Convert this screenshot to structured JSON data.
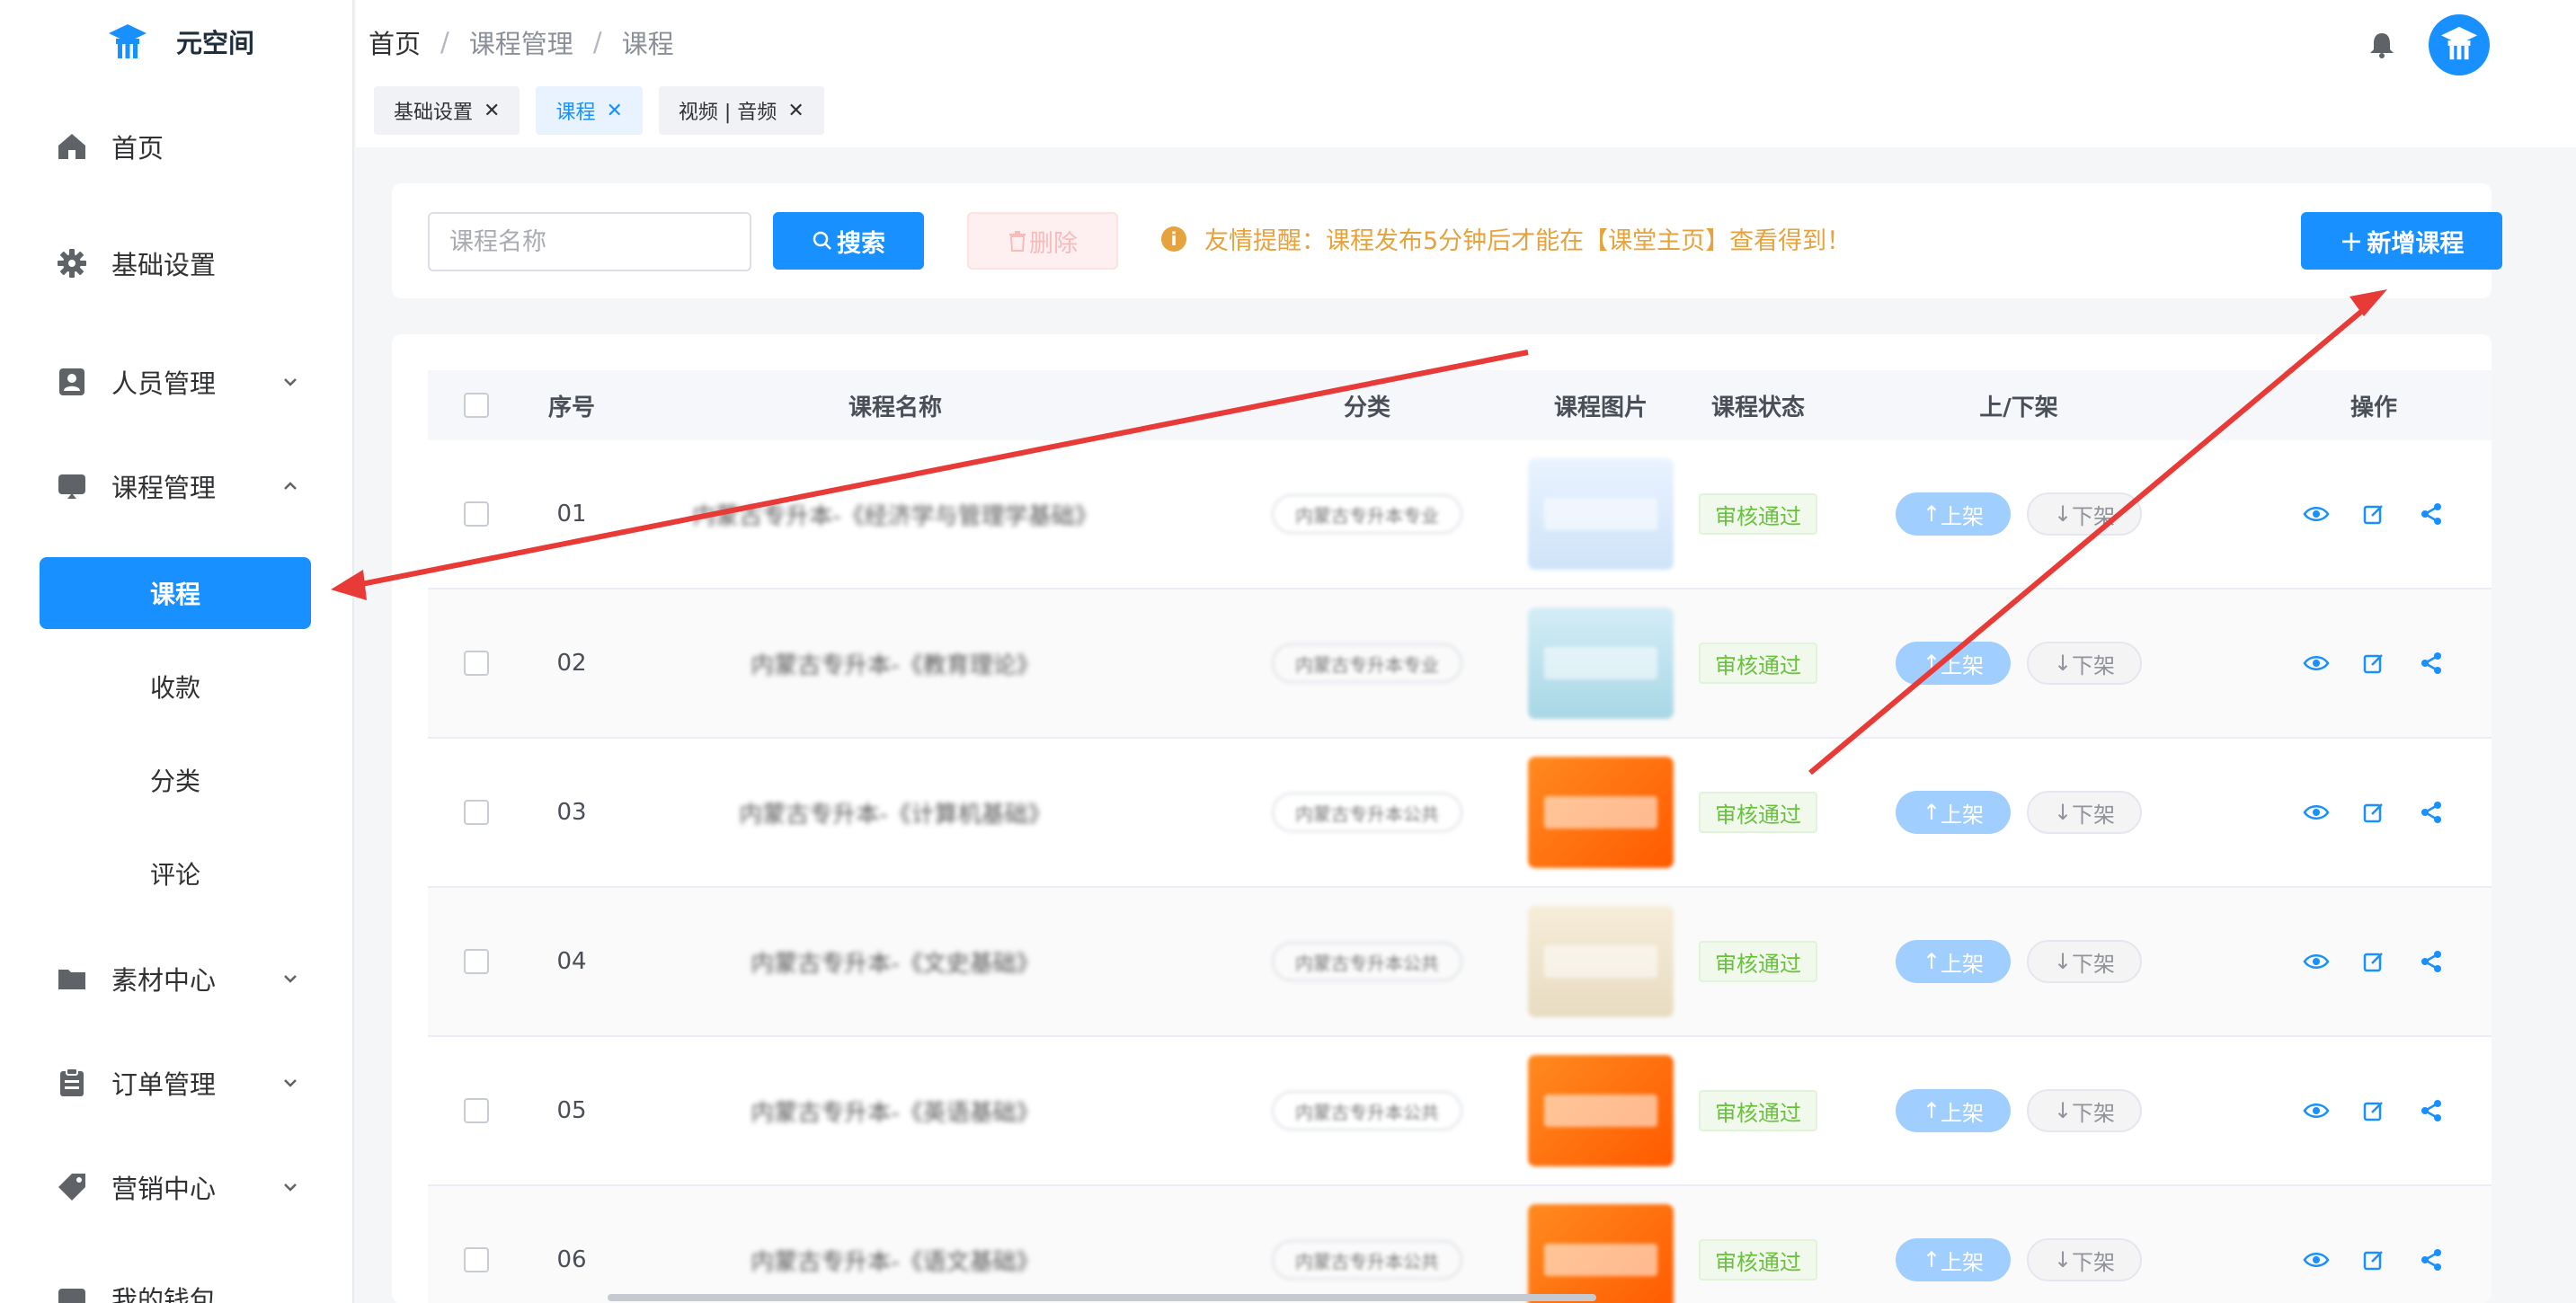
{
  "app": {
    "name": "元空间"
  },
  "sidebar": {
    "items": [
      {
        "label": "首页",
        "icon": "home-icon"
      },
      {
        "label": "基础设置",
        "icon": "gear-icon"
      },
      {
        "label": "人员管理",
        "icon": "person-card-icon"
      },
      {
        "label": "课程管理",
        "icon": "monitor-icon"
      },
      {
        "label": "素材中心",
        "icon": "folder-icon"
      },
      {
        "label": "订单管理",
        "icon": "clipboard-icon"
      },
      {
        "label": "营销中心",
        "icon": "tag-icon"
      },
      {
        "label": "我的钱包",
        "icon": "wallet-icon"
      }
    ],
    "sub_items": [
      {
        "label": "课程",
        "active": true
      },
      {
        "label": "收款"
      },
      {
        "label": "分类"
      },
      {
        "label": "评论"
      }
    ]
  },
  "breadcrumb": [
    "首页",
    "课程管理",
    "课程"
  ],
  "tabs": [
    {
      "label": "基础设置"
    },
    {
      "label": "课程",
      "active": true
    },
    {
      "label": "视频 | 音频"
    }
  ],
  "toolbar": {
    "search_placeholder": "课程名称",
    "search_label": "搜索",
    "delete_label": "删除",
    "notice": "友情提醒：课程发布5分钟后才能在【课堂主页】查看得到！",
    "add_label": "新增课程"
  },
  "table": {
    "headers": [
      "序号",
      "课程名称",
      "分类",
      "课程图片",
      "课程状态",
      "上/下架",
      "操作"
    ],
    "rows": [
      {
        "index": "01",
        "name": "内蒙古专升本-《经济学与管理学基础》",
        "category": "内蒙古专升本专业",
        "status": "审核通过",
        "thumb": "blue"
      },
      {
        "index": "02",
        "name": "内蒙古专升本-《教育理论》",
        "category": "内蒙古专升本专业",
        "status": "审核通过",
        "thumb": "teal"
      },
      {
        "index": "03",
        "name": "内蒙古专升本-《计算机基础》",
        "category": "内蒙古专升本公共",
        "status": "审核通过",
        "thumb": "orange"
      },
      {
        "index": "04",
        "name": "内蒙古专升本-《文史基础》",
        "category": "内蒙古专升本公共",
        "status": "审核通过",
        "thumb": "cream"
      },
      {
        "index": "05",
        "name": "内蒙古专升本-《英语基础》",
        "category": "内蒙古专升本公共",
        "status": "审核通过",
        "thumb": "orange"
      },
      {
        "index": "06",
        "name": "内蒙古专升本-《语文基础》",
        "category": "内蒙古专升本公共",
        "status": "审核通过",
        "thumb": "orange"
      }
    ],
    "shelf_up_label": "上架",
    "shelf_down_label": "下架"
  },
  "colors": {
    "primary": "#1890ff",
    "warning": "#e6a23c",
    "success": "#67c23a",
    "annotation": "#e83a36"
  }
}
